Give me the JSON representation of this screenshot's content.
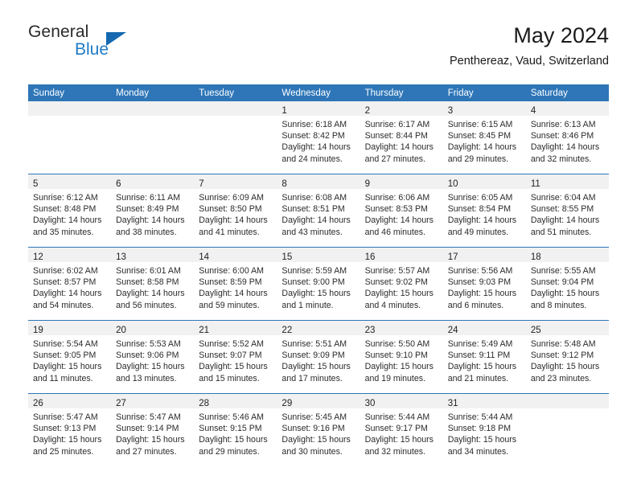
{
  "logo": {
    "word_top": "General",
    "word_bottom": "Blue",
    "triangle_icon": "triangle-icon",
    "accent_color": "#1f7ac4"
  },
  "header": {
    "title": "May 2024",
    "subtitle": "Penthereaz, Vaud, Switzerland",
    "header_row_color": "#2e76b8",
    "daynum_band_color": "#f1f1f1"
  },
  "weekdays": [
    "Sunday",
    "Monday",
    "Tuesday",
    "Wednesday",
    "Thursday",
    "Friday",
    "Saturday"
  ],
  "labels": {
    "sunrise_prefix": "Sunrise:",
    "sunset_prefix": "Sunset:",
    "daylight_prefix": "Daylight:"
  },
  "weeks": [
    [
      {
        "day": "",
        "lines": []
      },
      {
        "day": "",
        "lines": []
      },
      {
        "day": "",
        "lines": []
      },
      {
        "day": "1",
        "lines": [
          "Sunrise: 6:18 AM",
          "Sunset: 8:42 PM",
          "Daylight: 14 hours",
          "and 24 minutes."
        ]
      },
      {
        "day": "2",
        "lines": [
          "Sunrise: 6:17 AM",
          "Sunset: 8:44 PM",
          "Daylight: 14 hours",
          "and 27 minutes."
        ]
      },
      {
        "day": "3",
        "lines": [
          "Sunrise: 6:15 AM",
          "Sunset: 8:45 PM",
          "Daylight: 14 hours",
          "and 29 minutes."
        ]
      },
      {
        "day": "4",
        "lines": [
          "Sunrise: 6:13 AM",
          "Sunset: 8:46 PM",
          "Daylight: 14 hours",
          "and 32 minutes."
        ]
      }
    ],
    [
      {
        "day": "5",
        "lines": [
          "Sunrise: 6:12 AM",
          "Sunset: 8:48 PM",
          "Daylight: 14 hours",
          "and 35 minutes."
        ]
      },
      {
        "day": "6",
        "lines": [
          "Sunrise: 6:11 AM",
          "Sunset: 8:49 PM",
          "Daylight: 14 hours",
          "and 38 minutes."
        ]
      },
      {
        "day": "7",
        "lines": [
          "Sunrise: 6:09 AM",
          "Sunset: 8:50 PM",
          "Daylight: 14 hours",
          "and 41 minutes."
        ]
      },
      {
        "day": "8",
        "lines": [
          "Sunrise: 6:08 AM",
          "Sunset: 8:51 PM",
          "Daylight: 14 hours",
          "and 43 minutes."
        ]
      },
      {
        "day": "9",
        "lines": [
          "Sunrise: 6:06 AM",
          "Sunset: 8:53 PM",
          "Daylight: 14 hours",
          "and 46 minutes."
        ]
      },
      {
        "day": "10",
        "lines": [
          "Sunrise: 6:05 AM",
          "Sunset: 8:54 PM",
          "Daylight: 14 hours",
          "and 49 minutes."
        ]
      },
      {
        "day": "11",
        "lines": [
          "Sunrise: 6:04 AM",
          "Sunset: 8:55 PM",
          "Daylight: 14 hours",
          "and 51 minutes."
        ]
      }
    ],
    [
      {
        "day": "12",
        "lines": [
          "Sunrise: 6:02 AM",
          "Sunset: 8:57 PM",
          "Daylight: 14 hours",
          "and 54 minutes."
        ]
      },
      {
        "day": "13",
        "lines": [
          "Sunrise: 6:01 AM",
          "Sunset: 8:58 PM",
          "Daylight: 14 hours",
          "and 56 minutes."
        ]
      },
      {
        "day": "14",
        "lines": [
          "Sunrise: 6:00 AM",
          "Sunset: 8:59 PM",
          "Daylight: 14 hours",
          "and 59 minutes."
        ]
      },
      {
        "day": "15",
        "lines": [
          "Sunrise: 5:59 AM",
          "Sunset: 9:00 PM",
          "Daylight: 15 hours",
          "and 1 minute."
        ]
      },
      {
        "day": "16",
        "lines": [
          "Sunrise: 5:57 AM",
          "Sunset: 9:02 PM",
          "Daylight: 15 hours",
          "and 4 minutes."
        ]
      },
      {
        "day": "17",
        "lines": [
          "Sunrise: 5:56 AM",
          "Sunset: 9:03 PM",
          "Daylight: 15 hours",
          "and 6 minutes."
        ]
      },
      {
        "day": "18",
        "lines": [
          "Sunrise: 5:55 AM",
          "Sunset: 9:04 PM",
          "Daylight: 15 hours",
          "and 8 minutes."
        ]
      }
    ],
    [
      {
        "day": "19",
        "lines": [
          "Sunrise: 5:54 AM",
          "Sunset: 9:05 PM",
          "Daylight: 15 hours",
          "and 11 minutes."
        ]
      },
      {
        "day": "20",
        "lines": [
          "Sunrise: 5:53 AM",
          "Sunset: 9:06 PM",
          "Daylight: 15 hours",
          "and 13 minutes."
        ]
      },
      {
        "day": "21",
        "lines": [
          "Sunrise: 5:52 AM",
          "Sunset: 9:07 PM",
          "Daylight: 15 hours",
          "and 15 minutes."
        ]
      },
      {
        "day": "22",
        "lines": [
          "Sunrise: 5:51 AM",
          "Sunset: 9:09 PM",
          "Daylight: 15 hours",
          "and 17 minutes."
        ]
      },
      {
        "day": "23",
        "lines": [
          "Sunrise: 5:50 AM",
          "Sunset: 9:10 PM",
          "Daylight: 15 hours",
          "and 19 minutes."
        ]
      },
      {
        "day": "24",
        "lines": [
          "Sunrise: 5:49 AM",
          "Sunset: 9:11 PM",
          "Daylight: 15 hours",
          "and 21 minutes."
        ]
      },
      {
        "day": "25",
        "lines": [
          "Sunrise: 5:48 AM",
          "Sunset: 9:12 PM",
          "Daylight: 15 hours",
          "and 23 minutes."
        ]
      }
    ],
    [
      {
        "day": "26",
        "lines": [
          "Sunrise: 5:47 AM",
          "Sunset: 9:13 PM",
          "Daylight: 15 hours",
          "and 25 minutes."
        ]
      },
      {
        "day": "27",
        "lines": [
          "Sunrise: 5:47 AM",
          "Sunset: 9:14 PM",
          "Daylight: 15 hours",
          "and 27 minutes."
        ]
      },
      {
        "day": "28",
        "lines": [
          "Sunrise: 5:46 AM",
          "Sunset: 9:15 PM",
          "Daylight: 15 hours",
          "and 29 minutes."
        ]
      },
      {
        "day": "29",
        "lines": [
          "Sunrise: 5:45 AM",
          "Sunset: 9:16 PM",
          "Daylight: 15 hours",
          "and 30 minutes."
        ]
      },
      {
        "day": "30",
        "lines": [
          "Sunrise: 5:44 AM",
          "Sunset: 9:17 PM",
          "Daylight: 15 hours",
          "and 32 minutes."
        ]
      },
      {
        "day": "31",
        "lines": [
          "Sunrise: 5:44 AM",
          "Sunset: 9:18 PM",
          "Daylight: 15 hours",
          "and 34 minutes."
        ]
      },
      {
        "day": "",
        "lines": []
      }
    ]
  ]
}
